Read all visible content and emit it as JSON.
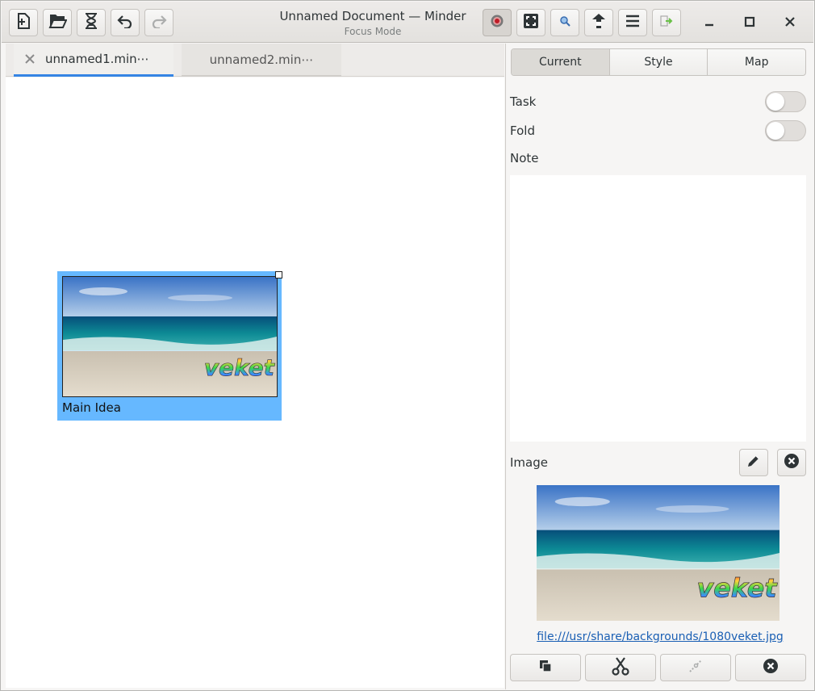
{
  "window": {
    "title": "Unnamed Document  —  Minder",
    "subtitle": "Focus Mode"
  },
  "toolbar": {
    "left_icons": [
      "new-document-icon",
      "open-document-icon",
      "save-hourglass-icon",
      "undo-icon",
      "redo-icon"
    ],
    "right_icons": [
      "focus-target-icon",
      "fit-icon",
      "search-icon",
      "export-icon",
      "menu-icon",
      "sidebar-toggle-icon"
    ]
  },
  "tabs": [
    {
      "label": "unnamed1.min⋯",
      "active": true
    },
    {
      "label": "unnamed2.min⋯",
      "active": false
    }
  ],
  "canvas": {
    "node": {
      "label": "Main Idea",
      "image_text": "veket"
    }
  },
  "sidebar": {
    "segments": [
      "Current",
      "Style",
      "Map"
    ],
    "selected_segment": "Current",
    "task_label": "Task",
    "task_on": false,
    "fold_label": "Fold",
    "fold_on": false,
    "note_label": "Note",
    "note_value": "",
    "image_label": "Image",
    "image_text": "veket",
    "image_path": "file:///usr/share/backgrounds/1080veket.jpg",
    "bottom_icons": [
      "copy-icon",
      "cut-icon",
      "paste-icon",
      "delete-icon"
    ]
  },
  "colors": {
    "accent": "#3584e4",
    "node_selected": "#66b8ff",
    "link": "#1a5fb4"
  }
}
